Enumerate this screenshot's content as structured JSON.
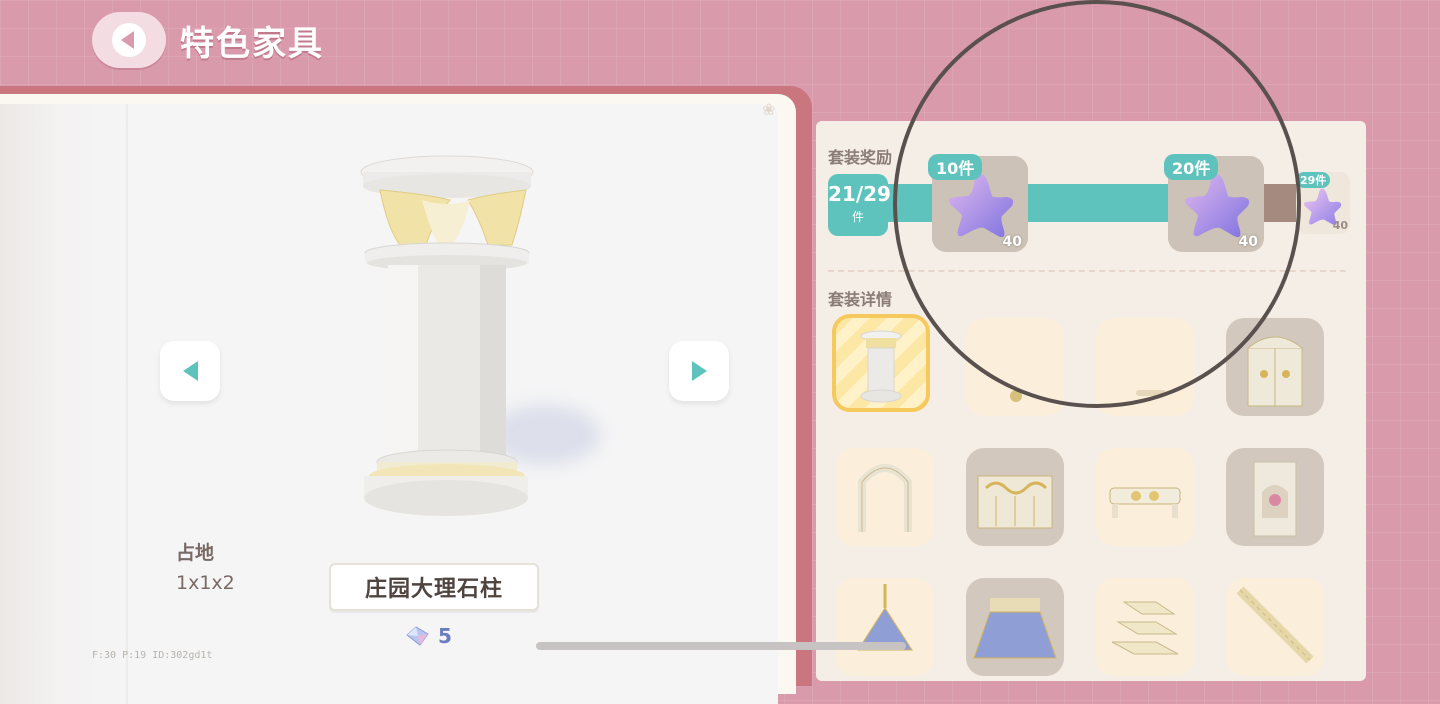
{
  "header": {
    "title": "特色家具",
    "back_icon": "back-arrow-icon"
  },
  "item": {
    "name": "庄园大理石柱",
    "footprint_label": "占地",
    "footprint_value": "1x1x2",
    "price": "5",
    "price_icon": "gem-icon",
    "debug_text": "F:30   P:19   ID:302gd1t"
  },
  "set_reward": {
    "label": "套装奖励",
    "count": "21/29",
    "count_unit": "件",
    "progress_fraction": 0.724,
    "rewards": [
      {
        "tag": "10件",
        "qty": "40",
        "icon": "star-icon"
      },
      {
        "tag": "20件",
        "qty": "40",
        "icon": "star-icon"
      },
      {
        "tag": "29件",
        "qty": "40",
        "icon": "star-icon"
      }
    ]
  },
  "set_detail": {
    "label": "套装详情",
    "items": [
      {
        "icon": "marble-pillar-icon",
        "state": "selected"
      },
      {
        "icon": "garden-lamp-icon",
        "state": "unowned"
      },
      {
        "icon": "garden-bench-icon",
        "state": "unowned"
      },
      {
        "icon": "ornate-gate-icon",
        "state": "owned"
      },
      {
        "icon": "arch-icon",
        "state": "unowned"
      },
      {
        "icon": "iron-fence-icon",
        "state": "owned"
      },
      {
        "icon": "railing-icon",
        "state": "unowned"
      },
      {
        "icon": "flower-niche-icon",
        "state": "owned"
      },
      {
        "icon": "pavilion-roof-icon",
        "state": "unowned"
      },
      {
        "icon": "gazebo-roof-icon",
        "state": "owned"
      },
      {
        "icon": "stone-steps-icon",
        "state": "unowned"
      },
      {
        "icon": "staircase-icon",
        "state": "unowned"
      }
    ]
  },
  "colors": {
    "accent": "#5fc3bd",
    "background": "#d99aac",
    "selected_border": "#f6c95e"
  }
}
